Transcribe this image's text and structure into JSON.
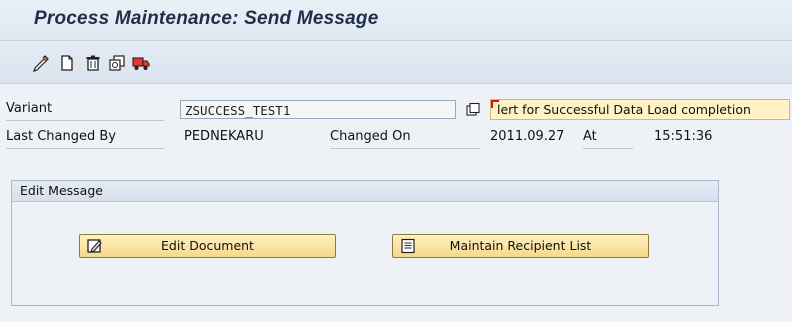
{
  "window": {
    "title": "Process Maintenance: Send Message"
  },
  "toolbar": {
    "buttons": [
      {
        "name": "edit-pencil-icon"
      },
      {
        "name": "new-document-icon"
      },
      {
        "name": "delete-icon"
      },
      {
        "name": "copy-icon"
      },
      {
        "name": "transport-icon"
      }
    ]
  },
  "form": {
    "variant_label": "Variant",
    "variant_value": "ZSUCCESS_TEST1",
    "variant_description": "lert for Successful Data Load completion",
    "last_changed_by_label": "Last Changed By",
    "last_changed_by_value": "PEDNEKARU",
    "changed_on_label": "Changed On",
    "changed_on_value": "2011.09.27",
    "at_label": "At",
    "at_value": "15:51:36"
  },
  "edit_message": {
    "header": "Edit Message",
    "edit_document_label": "Edit Document",
    "maintain_recipient_label": "Maintain Recipient List"
  },
  "colors": {
    "button_fill": "#f5d88a",
    "field_highlight": "#fff2c6",
    "title_text": "#1f2f4a"
  }
}
